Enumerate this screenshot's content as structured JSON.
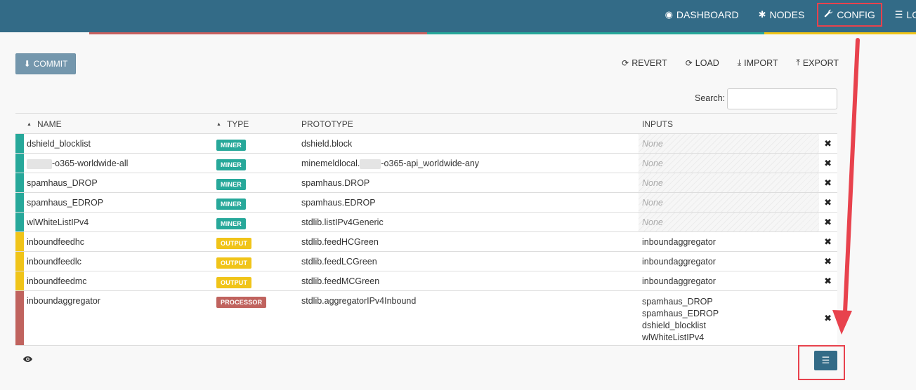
{
  "nav": {
    "items": [
      {
        "label": "DASHBOARD",
        "icon": "dashboard-icon",
        "glyph": "◉"
      },
      {
        "label": "NODES",
        "icon": "asterisk-icon",
        "glyph": "✱"
      },
      {
        "label": "CONFIG",
        "icon": "wrench-icon",
        "glyph": "🔧"
      },
      {
        "label": "LOG",
        "icon": "list-icon",
        "glyph": "☰"
      }
    ]
  },
  "toolbar": {
    "commit_label": "COMMIT",
    "revert_label": "REVERT",
    "load_label": "LOAD",
    "import_label": "IMPORT",
    "export_label": "EXPORT"
  },
  "search": {
    "label": "Search:",
    "value": ""
  },
  "table": {
    "headers": {
      "name": "NAME",
      "type": "TYPE",
      "prototype": "PROTOTYPE",
      "inputs": "INPUTS"
    },
    "none_label": "None",
    "rows": [
      {
        "name": "dshield_blocklist",
        "type": "MINER",
        "prototype": "dshield.block",
        "inputs": []
      },
      {
        "name": "-o365-worldwide-all",
        "type": "MINER",
        "prototype_prefix": "minemeldlocal.",
        "prototype": "-o365-api_worldwide-any",
        "inputs": []
      },
      {
        "name": "spamhaus_DROP",
        "type": "MINER",
        "prototype": "spamhaus.DROP",
        "inputs": []
      },
      {
        "name": "spamhaus_EDROP",
        "type": "MINER",
        "prototype": "spamhaus.EDROP",
        "inputs": []
      },
      {
        "name": "wlWhiteListIPv4",
        "type": "MINER",
        "prototype": "stdlib.listIPv4Generic",
        "inputs": []
      },
      {
        "name": "inboundfeedhc",
        "type": "OUTPUT",
        "prototype": "stdlib.feedHCGreen",
        "inputs": [
          "inboundaggregator"
        ]
      },
      {
        "name": "inboundfeedlc",
        "type": "OUTPUT",
        "prototype": "stdlib.feedLCGreen",
        "inputs": [
          "inboundaggregator"
        ]
      },
      {
        "name": "inboundfeedmc",
        "type": "OUTPUT",
        "prototype": "stdlib.feedMCGreen",
        "inputs": [
          "inboundaggregator"
        ]
      },
      {
        "name": "inboundaggregator",
        "type": "PROCESSOR",
        "prototype": "stdlib.aggregatorIPv4Inbound",
        "inputs": [
          "spamhaus_DROP",
          "spamhaus_EDROP",
          "dshield_blocklist",
          "wlWhiteListIPv4"
        ]
      }
    ]
  },
  "colors": {
    "navbar": "#336b87",
    "MINER": "#27a89a",
    "OUTPUT": "#f0c419",
    "PROCESSOR": "#c0635e",
    "highlight": "#e8424d"
  }
}
